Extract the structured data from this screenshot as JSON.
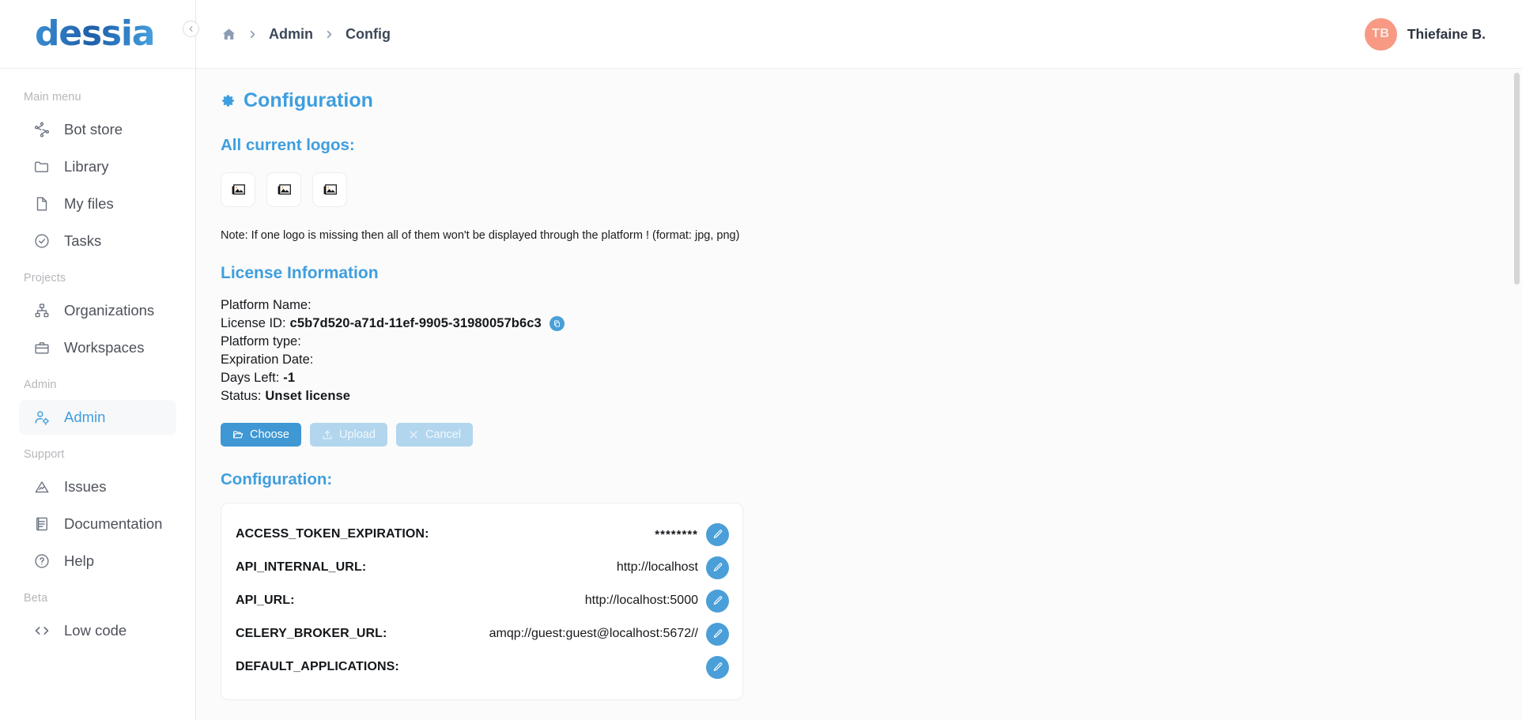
{
  "brand": {
    "logo_text": "dessia"
  },
  "sidebar": {
    "collapse_icon": "chevron-left-icon",
    "groups": [
      {
        "label": "Main menu",
        "items": [
          {
            "label": "Bot store",
            "icon": "nodes-icon",
            "active": false
          },
          {
            "label": "Library",
            "icon": "folder-icon",
            "active": false
          },
          {
            "label": "My files",
            "icon": "file-icon",
            "active": false
          },
          {
            "label": "Tasks",
            "icon": "check-circle-icon",
            "active": false
          }
        ]
      },
      {
        "label": "Projects",
        "items": [
          {
            "label": "Organizations",
            "icon": "sitemap-icon",
            "active": false
          },
          {
            "label": "Workspaces",
            "icon": "briefcase-icon",
            "active": false
          }
        ]
      },
      {
        "label": "Admin",
        "items": [
          {
            "label": "Admin",
            "icon": "user-gear-icon",
            "active": true
          }
        ]
      },
      {
        "label": "Support",
        "items": [
          {
            "label": "Issues",
            "icon": "warning-triangle-icon",
            "active": false
          },
          {
            "label": "Documentation",
            "icon": "book-icon",
            "active": false
          },
          {
            "label": "Help",
            "icon": "question-circle-icon",
            "active": false
          }
        ]
      },
      {
        "label": "Beta",
        "items": [
          {
            "label": "Low code",
            "icon": "code-brackets-icon",
            "active": false
          }
        ]
      }
    ]
  },
  "topbar": {
    "breadcrumb": {
      "home_icon": "home-icon",
      "items": [
        "Admin",
        "Config"
      ],
      "separator_icon": "chevron-right-icon"
    },
    "user": {
      "initials": "TB",
      "name": "Thiefaine B.",
      "avatar_color": "#f79983"
    }
  },
  "page": {
    "title": "Configuration",
    "title_icon": "gear-icon",
    "logos_section": {
      "title": "All current logos:",
      "boxes": [
        {
          "icon": "broken-image-icon"
        },
        {
          "icon": "broken-image-icon"
        },
        {
          "icon": "broken-image-icon"
        }
      ],
      "note": "Note: If one logo is missing then all of them won't be displayed through the platform ! (format: jpg, png)"
    },
    "license_section": {
      "title": "License Information",
      "fields": [
        {
          "label": "Platform Name:",
          "value": ""
        },
        {
          "label": "License ID:",
          "value": "c5b7d520-a71d-11ef-9905-31980057b6c3",
          "copy_icon": "copy-icon"
        },
        {
          "label": "Platform type:",
          "value": ""
        },
        {
          "label": "Expiration Date:",
          "value": ""
        },
        {
          "label": "Days Left:",
          "value": "-1"
        },
        {
          "label": "Status:",
          "value": "Unset license"
        }
      ],
      "buttons": [
        {
          "label": "Choose",
          "icon": "folder-open-icon",
          "state": "primary"
        },
        {
          "label": "Upload",
          "icon": "upload-icon",
          "state": "disabled"
        },
        {
          "label": "Cancel",
          "icon": "close-icon",
          "state": "disabled"
        }
      ]
    },
    "config_section": {
      "title": "Configuration:",
      "edit_icon": "pencil-icon",
      "rows": [
        {
          "key": "ACCESS_TOKEN_EXPIRATION:",
          "value": "********",
          "masked": true
        },
        {
          "key": "API_INTERNAL_URL:",
          "value": "http://localhost",
          "masked": false
        },
        {
          "key": "API_URL:",
          "value": "http://localhost:5000",
          "masked": false
        },
        {
          "key": "CELERY_BROKER_URL:",
          "value": "amqp://guest:guest@localhost:5672//",
          "masked": false
        },
        {
          "key": "DEFAULT_APPLICATIONS:",
          "value": "",
          "masked": false
        }
      ]
    }
  },
  "colors": {
    "accent": "#3f9ede",
    "accent_button": "#3f97d4",
    "accent_circle": "#4a9fd8",
    "disabled_button": "#b2d6ee",
    "avatar": "#f79983",
    "text": "#15181c",
    "muted": "#b6b6bb"
  }
}
